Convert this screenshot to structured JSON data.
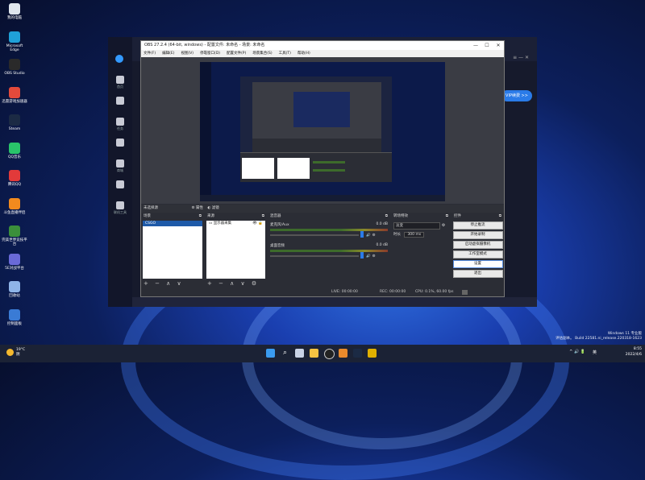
{
  "desktop": {
    "icons": [
      {
        "label": "我的电脑",
        "color": "#dfe6ee"
      },
      {
        "label": "Microsoft Edge",
        "color": "#1fa0d8"
      },
      {
        "label": "OBS Studio",
        "color": "#2a2a2a"
      },
      {
        "label": "迅雷游戏加速器",
        "color": "#e44a3b"
      },
      {
        "label": "Steam",
        "color": "#1b2a44"
      },
      {
        "label": "QQ音乐",
        "color": "#29c36a"
      },
      {
        "label": "腾讯QQ",
        "color": "#e23a3a"
      },
      {
        "label": "斗鱼直播伴侣",
        "color": "#f28a1e"
      },
      {
        "label": "完美世界竞技平台",
        "color": "#3b8f3b"
      },
      {
        "label": "5E对战平台",
        "color": "#6a6ad8"
      },
      {
        "label": "回收站",
        "color": "#8fb4e8"
      },
      {
        "label": "控制面板",
        "color": "#3a7bd5"
      }
    ]
  },
  "back_app": {
    "rail_items": [
      "首页",
      "",
      "任务",
      "",
      "商城",
      "",
      "联机工具"
    ],
    "vip_button": "VIP续费 >>",
    "win_controls": "≡ — ✕"
  },
  "obs": {
    "title": "OBS 27.2.4 (64-bit, windows) - 配置文件: 未命名 - 场景: 未命名",
    "menu": [
      "文件(F)",
      "编辑(E)",
      "视图(V)",
      "停靠窗口(D)",
      "配置文件(P)",
      "场景集合(S)",
      "工具(T)",
      "帮助(H)"
    ],
    "status_row": {
      "no_source": "未选择源",
      "properties": "属性",
      "filters": "滤镜"
    },
    "docks": {
      "scenes": {
        "header": "场景",
        "items": [
          "CSGO"
        ]
      },
      "sources": {
        "header": "来源",
        "items": [
          "显示器采集"
        ]
      },
      "mixer": {
        "header": "混音器",
        "tracks": [
          {
            "name": "麦克风/Aux",
            "db": "0.0 dB"
          },
          {
            "name": "桌面音频",
            "db": "0.0 dB"
          }
        ]
      },
      "transitions": {
        "header": "转场特效",
        "type": "淡变",
        "duration_label": "时长",
        "duration": "300 ms"
      },
      "controls": {
        "header": "控件",
        "buttons": [
          "停止推流",
          "开始录制",
          "启动虚拟摄像机",
          "工作室模式",
          "设置",
          "退出"
        ],
        "highlighted_index": 4
      }
    },
    "footer": {
      "live": "LIVE: 00:00:00",
      "rec": "REC: 00:00:00",
      "cpu": "CPU: 0.1%, 60.00 fps"
    },
    "toolbar_glyphs": "+ − ∧ ∨"
  },
  "taskbar": {
    "weather_temp": "19°C",
    "weather_desc": "阴",
    "lang": "英",
    "time": "8:55",
    "date": "2022/4/6"
  },
  "watermark": {
    "line1": "Windows 11 专业版",
    "line2": "评估副本。 Build 22581.ni_release.220318-1623"
  }
}
